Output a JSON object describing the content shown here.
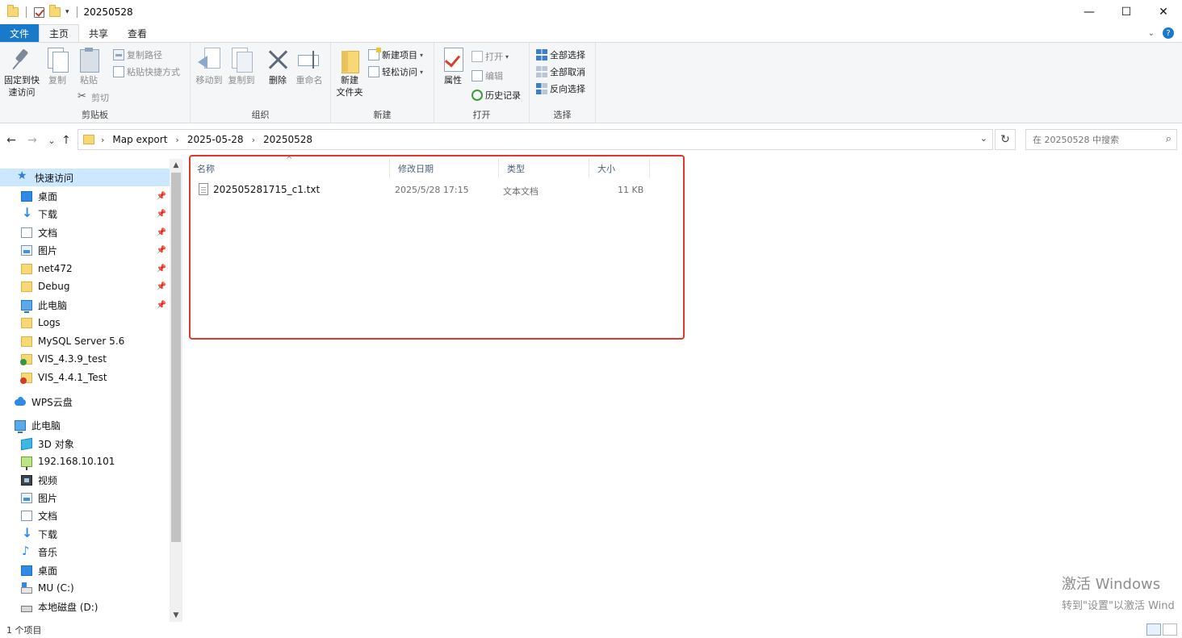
{
  "window": {
    "title": "20250528",
    "controls": {
      "minimize": "—",
      "maximize": "☐",
      "close": "✕"
    }
  },
  "ribbon_tabs": [
    "文件",
    "主页",
    "共享",
    "查看"
  ],
  "ribbon": {
    "clipboard": {
      "label": "剪贴板",
      "pin_label_1": "固定到快",
      "pin_label_2": "速访问",
      "copy": "复制",
      "paste": "粘贴",
      "copy_path": "复制路径",
      "paste_shortcut": "粘贴快捷方式",
      "cut": "剪切"
    },
    "organize": {
      "label": "组织",
      "move_to": "移动到",
      "copy_to": "复制到",
      "delete": "删除",
      "rename": "重命名"
    },
    "new": {
      "label": "新建",
      "new_folder_1": "新建",
      "new_folder_2": "文件夹",
      "new_item": "新建项目",
      "easy_access": "轻松访问"
    },
    "open": {
      "label": "打开",
      "properties": "属性",
      "open": "打开",
      "edit": "编辑",
      "history": "历史记录"
    },
    "select": {
      "label": "选择",
      "select_all": "全部选择",
      "select_none": "全部取消",
      "invert": "反向选择"
    }
  },
  "nav": {
    "back": "←",
    "forward": "→",
    "recent": "⌄",
    "up": "↑",
    "breadcrumb": [
      "Map export",
      "2025-05-28",
      "20250528"
    ],
    "refresh": "↻",
    "search_placeholder": "在 20250528 中搜索"
  },
  "sidebar": {
    "quick_access": "快速访问",
    "items": [
      {
        "label": "桌面",
        "pinned": true
      },
      {
        "label": "下载",
        "pinned": true
      },
      {
        "label": "文档",
        "pinned": true
      },
      {
        "label": "图片",
        "pinned": true
      },
      {
        "label": "net472",
        "pinned": true
      },
      {
        "label": "Debug",
        "pinned": true
      },
      {
        "label": "此电脑",
        "pinned": true
      },
      {
        "label": "Logs",
        "pinned": false
      },
      {
        "label": "MySQL Server 5.6",
        "pinned": false
      },
      {
        "label": "VIS_4.3.9_test",
        "pinned": false
      },
      {
        "label": "VIS_4.4.1_Test",
        "pinned": false
      }
    ],
    "wps_cloud": "WPS云盘",
    "this_pc": "此电脑",
    "pc_items": [
      "3D 对象",
      "192.168.10.101",
      "视频",
      "图片",
      "文档",
      "下载",
      "音乐",
      "桌面",
      "MU (C:)",
      "本地磁盘 (D:)"
    ],
    "pin_glyph": "📌"
  },
  "columns": {
    "name": "名称",
    "modified": "修改日期",
    "type": "类型",
    "size": "大小"
  },
  "files": [
    {
      "name": "202505281715_c1.txt",
      "modified": "2025/5/28 17:15",
      "type": "文本文档",
      "size": "11 KB"
    }
  ],
  "status": {
    "count": "1 个项目"
  },
  "watermark": {
    "line1": "激活 Windows",
    "line2": "转到\"设置\"以激活 Wind"
  },
  "colors": {
    "file_tab": "#1979ca",
    "selection": "#cce8ff",
    "highlight_box": "#e0392b"
  }
}
